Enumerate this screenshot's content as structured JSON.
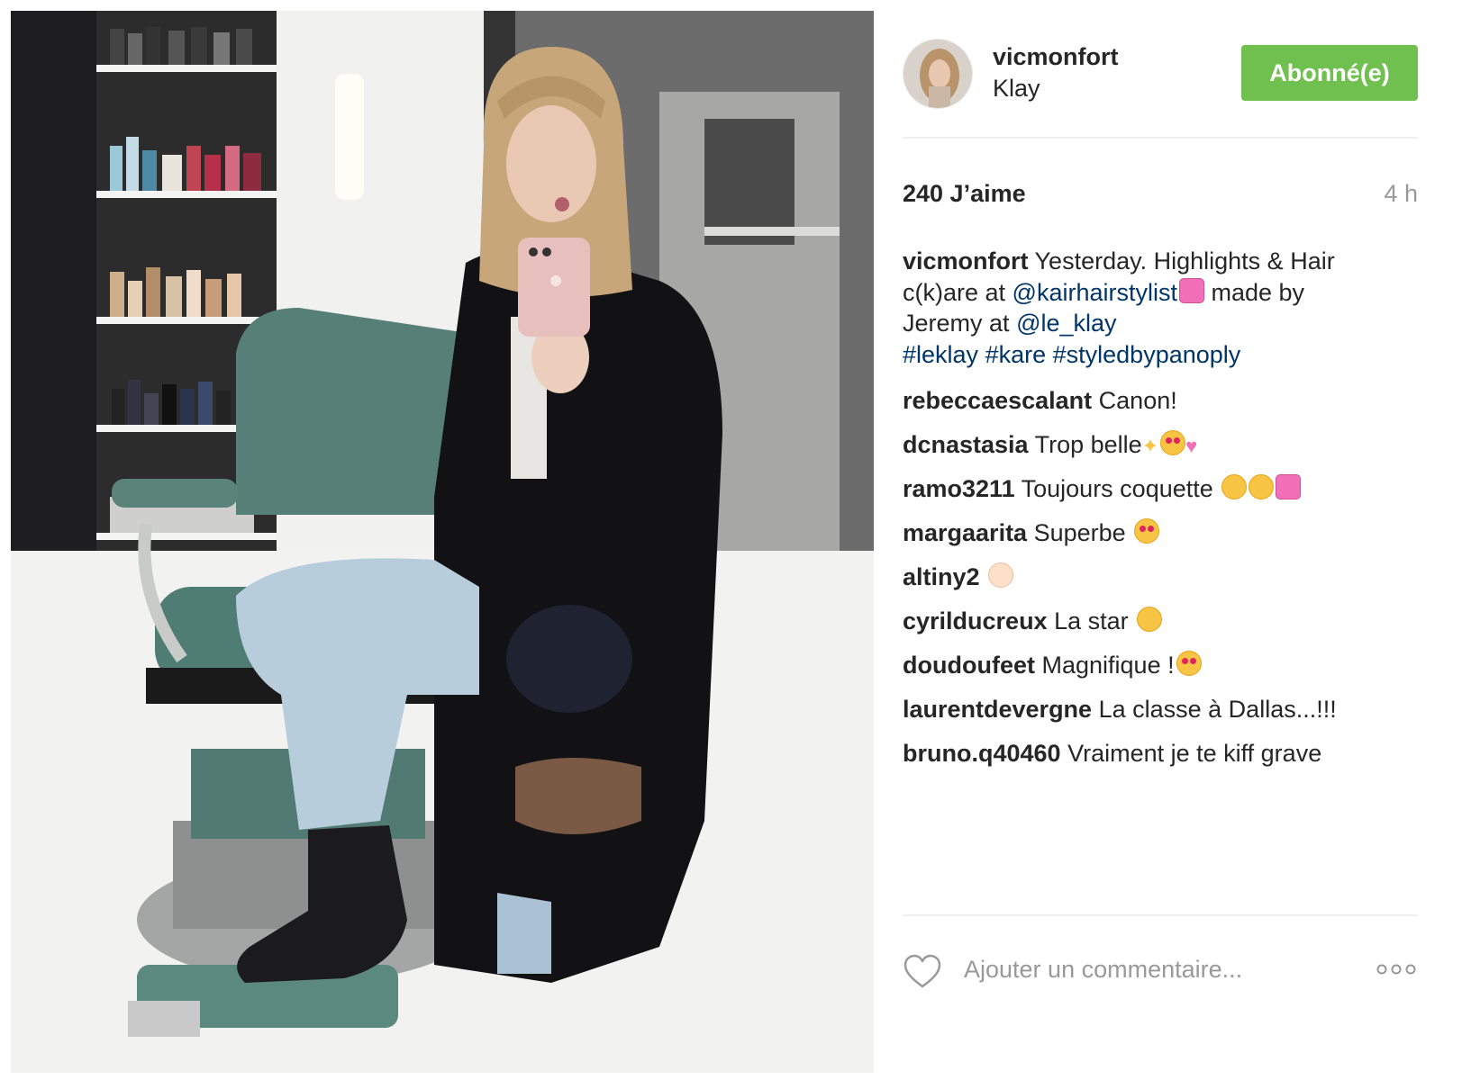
{
  "post": {
    "username": "vicmonfort",
    "location": "Klay",
    "follow_label": "Abonné(e)",
    "likes": "240 J’aime",
    "time": "4 h",
    "caption": {
      "username": "vicmonfort",
      "text_1": "Yesterday. Highlights & Hair c(k)are at",
      "mention_1": "@kairhairstylist",
      "text_2": "made by Jeremy at",
      "mention_2": "@le_klay",
      "tag_1": "#leklay",
      "tag_2": "#kare",
      "tag_3": "#styledbypanoply"
    },
    "comments": [
      {
        "user": "rebeccaescalant",
        "text": "Canon!"
      },
      {
        "user": "dcnastasia",
        "text": "Trop belle"
      },
      {
        "user": "ramo3211",
        "text": "Toujours coquette"
      },
      {
        "user": "margaarita",
        "text": "Superbe"
      },
      {
        "user": "altiny2",
        "text": ""
      },
      {
        "user": "cyrilducreux",
        "text": "La star"
      },
      {
        "user": "doudoufeet",
        "text": "Magnifique !"
      },
      {
        "user": "laurentdevergne",
        "text": "La classe à Dallas...!!!"
      },
      {
        "user": "bruno.q40460",
        "text": "Vraiment je te kiff grave"
      }
    ],
    "comment_placeholder": "Ajouter un commentaire...",
    "icons": {
      "like": "heart-outline-icon",
      "more": "more-options-icon",
      "emoji_hair": "haircut-emoji",
      "emoji_sparkles": "sparkles-emoji",
      "emoji_heart_eyes_cat": "heart-eyes-cat-emoji",
      "emoji_two_hearts": "two-hearts-emoji",
      "emoji_smile": "smiling-face-emoji",
      "emoji_heart": "heart-emoji",
      "emoji_heart_eyes": "heart-eyes-emoji",
      "emoji_ok_hand": "ok-hand-emoji",
      "emoji_wink": "winking-face-emoji"
    },
    "colors": {
      "follow_button": "#70c050",
      "link": "#003569",
      "muted": "#999999"
    }
  }
}
